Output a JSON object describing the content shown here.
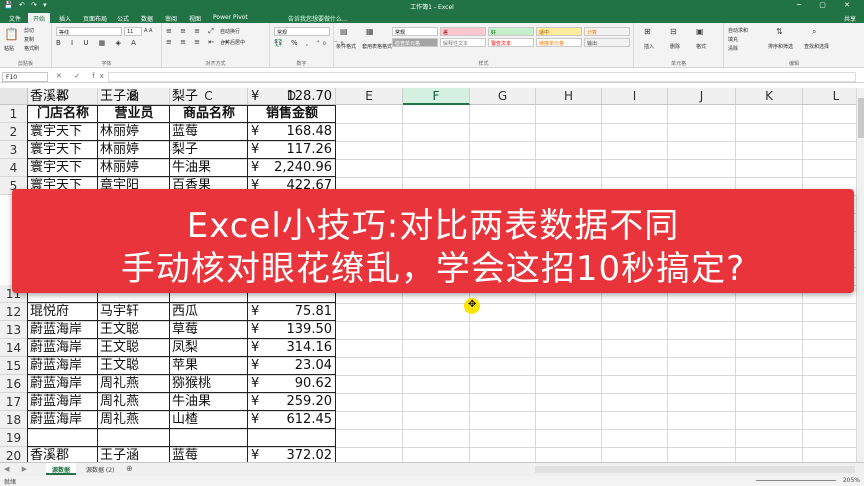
{
  "window": {
    "title": "工作簿1 - Excel",
    "share": "共享"
  },
  "tabs": [
    {
      "label": "文件"
    },
    {
      "label": "开始"
    },
    {
      "label": "插入"
    },
    {
      "label": "页面布局"
    },
    {
      "label": "公式"
    },
    {
      "label": "数据"
    },
    {
      "label": "审阅"
    },
    {
      "label": "视图"
    },
    {
      "label": "Power Pivot"
    }
  ],
  "tellme": "告诉我您想要做什么...",
  "ribbon": {
    "clipboard": {
      "label": "剪贴板",
      "paste": "粘贴",
      "cut": "剪切",
      "copy": "复制",
      "format_painter": "格式刷"
    },
    "font": {
      "label": "字体",
      "name": "等线",
      "size": "11"
    },
    "alignment": {
      "label": "对齐方式",
      "wrap": "自动换行",
      "merge": "合并后居中"
    },
    "number": {
      "label": "数字",
      "format": "常规"
    },
    "styles": {
      "label": "样式",
      "conditional": "条件格式",
      "table": "套用表格格式",
      "cells": [
        {
          "name": "常规",
          "bg": "#ffffff",
          "fg": "#000000"
        },
        {
          "name": "差",
          "bg": "#ffc7ce",
          "fg": "#9c0006"
        },
        {
          "name": "好",
          "bg": "#c6efce",
          "fg": "#006100"
        },
        {
          "name": "适中",
          "bg": "#ffeb9c",
          "fg": "#9c5700"
        },
        {
          "name": "计算",
          "bg": "#f2f2f2",
          "fg": "#fa7d00"
        },
        {
          "name": "检查单元格",
          "bg": "#a5a5a5",
          "fg": "#ffffff"
        },
        {
          "name": "解释性文本",
          "bg": "#ffffff",
          "fg": "#7f7f7f"
        },
        {
          "name": "警告文本",
          "bg": "#ffffff",
          "fg": "#ff0000"
        },
        {
          "name": "链接单元格",
          "bg": "#ffffff",
          "fg": "#fa7d00"
        },
        {
          "name": "输出",
          "bg": "#f2f2f2",
          "fg": "#3f3f3f"
        }
      ]
    },
    "cells_group": {
      "label": "单元格",
      "insert": "插入",
      "delete": "删除",
      "format": "格式"
    },
    "editing": {
      "label": "编辑",
      "autosum": "自动求和",
      "fill": "填充",
      "clear": "清除",
      "sort": "排序和筛选",
      "find": "查找和选择"
    }
  },
  "formula_bar": {
    "name_box": "F10",
    "content": ""
  },
  "columns": [
    "A",
    "B",
    "C",
    "D",
    "E",
    "F",
    "G",
    "H",
    "I",
    "J",
    "K",
    "L"
  ],
  "selected_column": "F",
  "table": {
    "headers": [
      "门店名称",
      "营业员",
      "商品名称",
      "销售金额"
    ],
    "currency": "¥",
    "rows": [
      {
        "row": "2",
        "store": "寰宇天下",
        "clerk": "林丽婷",
        "product": "蓝莓",
        "amount": "168.48"
      },
      {
        "row": "3",
        "store": "寰宇天下",
        "clerk": "林丽婷",
        "product": "梨子",
        "amount": "117.26"
      },
      {
        "row": "4",
        "store": "寰宇天下",
        "clerk": "林丽婷",
        "product": "牛油果",
        "amount": "2,240.96"
      },
      {
        "row": "5",
        "store": "寰宇天下",
        "clerk": "章宇阳",
        "product": "百香果",
        "amount": "422.67"
      },
      {
        "row": "12",
        "store": "琨悦府",
        "clerk": "马宇轩",
        "product": "西瓜",
        "amount": "75.81"
      },
      {
        "row": "13",
        "store": "蔚蓝海岸",
        "clerk": "王文聪",
        "product": "草莓",
        "amount": "139.50"
      },
      {
        "row": "14",
        "store": "蔚蓝海岸",
        "clerk": "王文聪",
        "product": "凤梨",
        "amount": "314.16"
      },
      {
        "row": "15",
        "store": "蔚蓝海岸",
        "clerk": "王文聪",
        "product": "苹果",
        "amount": "23.04"
      },
      {
        "row": "16",
        "store": "蔚蓝海岸",
        "clerk": "周礼燕",
        "product": "猕猴桃",
        "amount": "90.62"
      },
      {
        "row": "17",
        "store": "蔚蓝海岸",
        "clerk": "周礼燕",
        "product": "牛油果",
        "amount": "259.20"
      },
      {
        "row": "18",
        "store": "蔚蓝海岸",
        "clerk": "周礼燕",
        "product": "山楂",
        "amount": "612.45"
      },
      {
        "row": "20",
        "store": "香溪郡",
        "clerk": "王子涵",
        "product": "蓝莓",
        "amount": "372.02"
      },
      {
        "row": "21",
        "store": "香溪郡",
        "clerk": "王子涵",
        "product": "梨子",
        "amount": "128.70"
      }
    ]
  },
  "row_numbers": [
    "1",
    "2",
    "3",
    "4",
    "5",
    "11",
    "12",
    "13",
    "14",
    "15",
    "16",
    "17",
    "18",
    "19",
    "20"
  ],
  "banner": {
    "line1": "Excel小技巧:对比两表数据不同",
    "line2": "手动核对眼花缭乱，学会这招10秒搞定?"
  },
  "sheets": [
    {
      "name": "源数据",
      "active": true
    },
    {
      "name": "源数据 (2)",
      "active": false
    }
  ],
  "status": {
    "ready": "就绪",
    "zoom": "205%"
  }
}
